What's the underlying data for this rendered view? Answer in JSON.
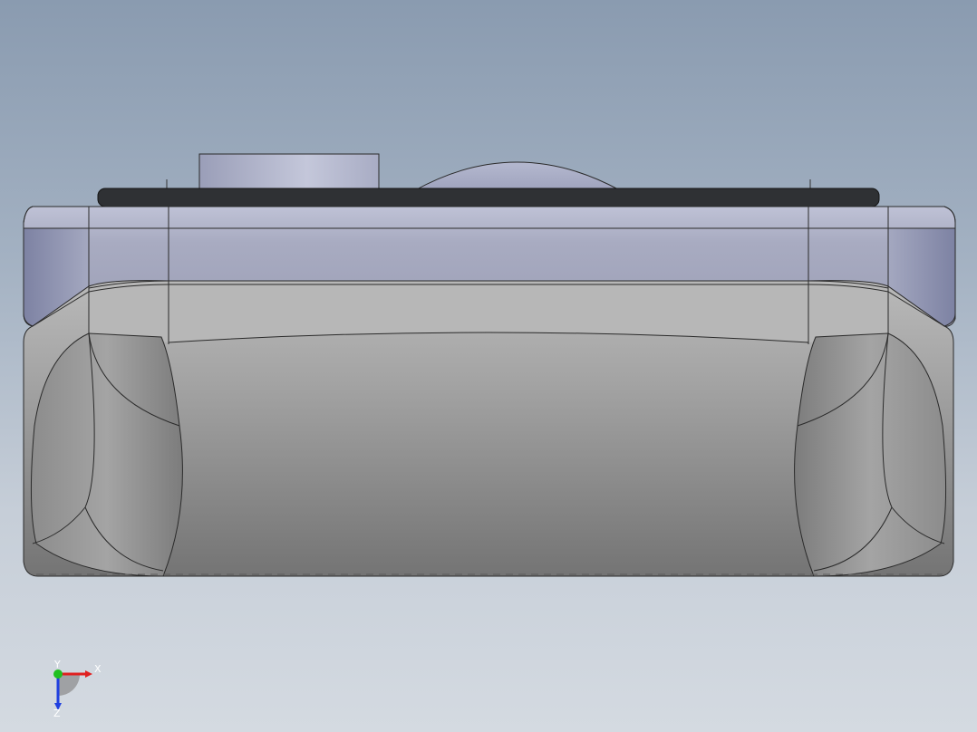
{
  "viewport": {
    "model": "3d-part-front-view"
  },
  "triad": {
    "x_label": "X",
    "y_label": "Y",
    "z_label": "Z"
  },
  "colors": {
    "background_top": "#8a9bb0",
    "background_bottom": "#d4dae1",
    "upper_band": "#a7acc4",
    "lower_body": "#8e8e8e",
    "top_strip": "#2f3134",
    "cylinder": "#b8bccf",
    "axis_x": "#e02020",
    "axis_y": "#20c020",
    "axis_z": "#2040e0"
  }
}
